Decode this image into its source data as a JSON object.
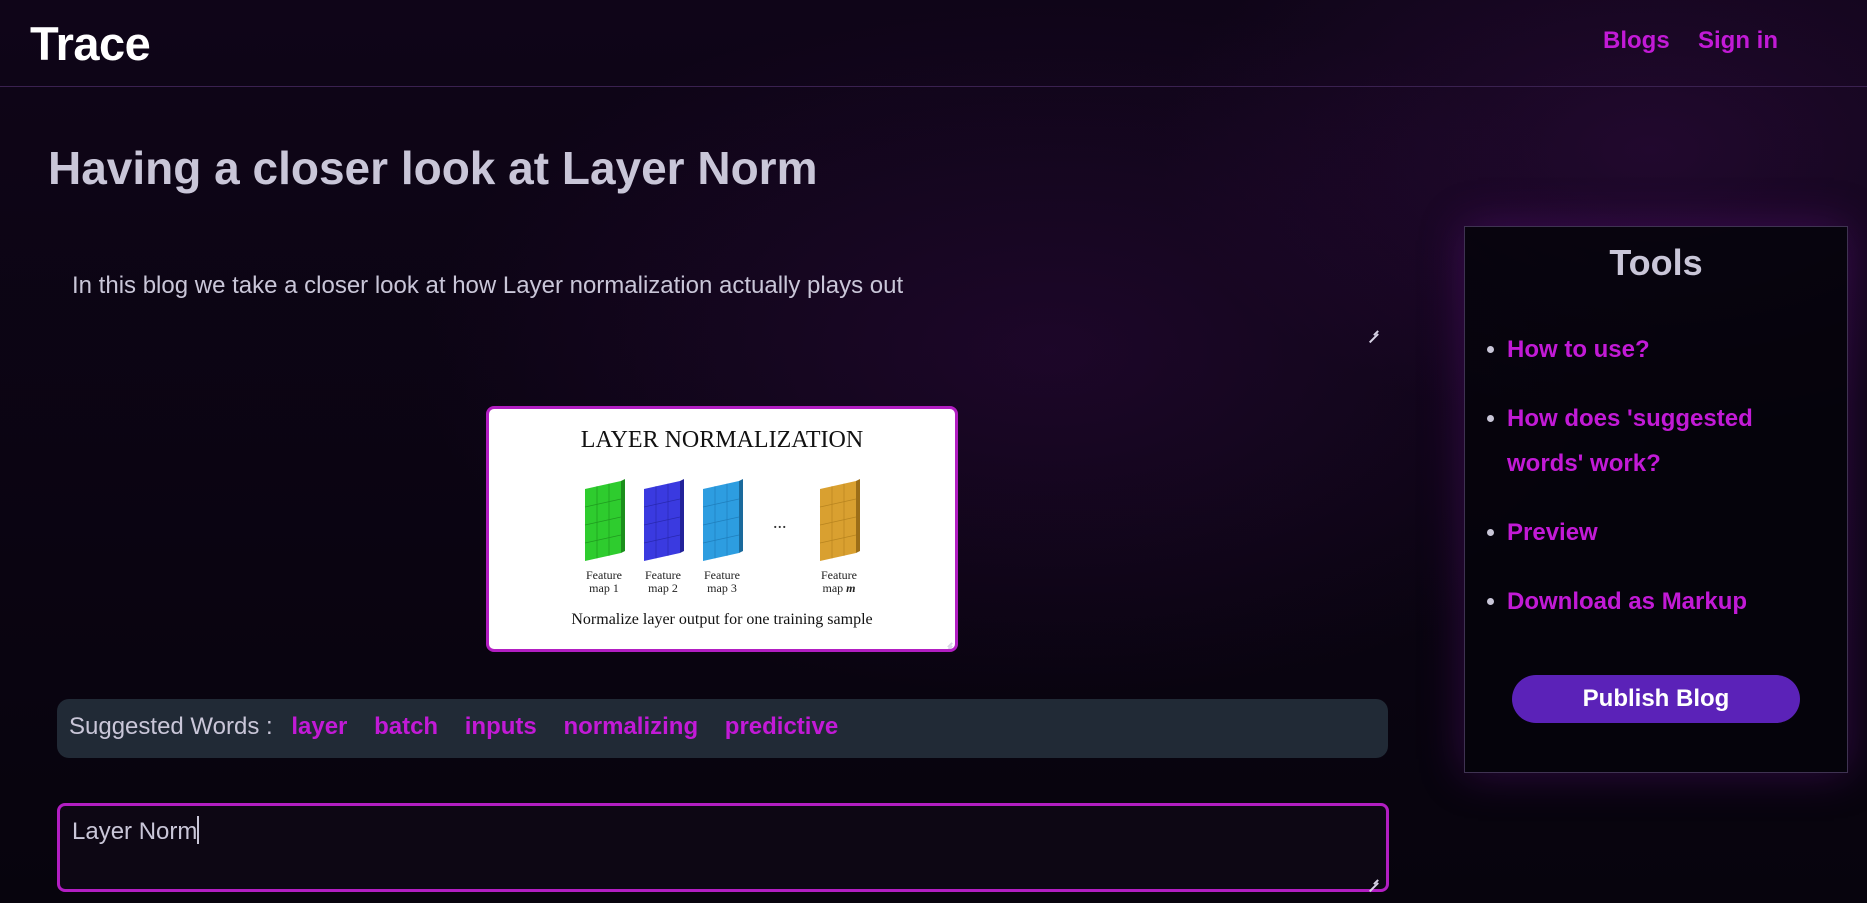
{
  "navbar": {
    "brand": "Trace",
    "links": [
      "Blogs",
      "Sign in"
    ]
  },
  "editor": {
    "title": "Having a closer look at Layer Norm",
    "summary": "In this blog we take a closer look at  how Layer normalization actually plays out",
    "content": "Layer Norm"
  },
  "figure": {
    "title": "LAYER NORMALIZATION",
    "maps": [
      {
        "line1": "Feature",
        "line2": "map 1",
        "color": "#2ecc2e"
      },
      {
        "line1": "Feature",
        "line2": "map 2",
        "color": "#3a3ae0"
      },
      {
        "line1": "Feature",
        "line2": "map 3",
        "color": "#2d9de0"
      },
      {
        "line1": "Feature",
        "line2": "map m",
        "color": "#d9a030"
      }
    ],
    "dots": "...",
    "caption": "Normalize layer output for one training sample"
  },
  "suggested": {
    "label": "Suggested Words :",
    "words": [
      "layer",
      "batch",
      "inputs",
      "normalizing",
      "predictive"
    ]
  },
  "tools": {
    "title": "Tools",
    "items": [
      "How to use?",
      "How does 'suggested words' work?",
      "Preview",
      "Download as Markup"
    ],
    "publish_label": "Publish Blog"
  },
  "colors": {
    "accent": "#c21ad6",
    "button": "#5b22b8",
    "text": "#c9c6d8"
  }
}
